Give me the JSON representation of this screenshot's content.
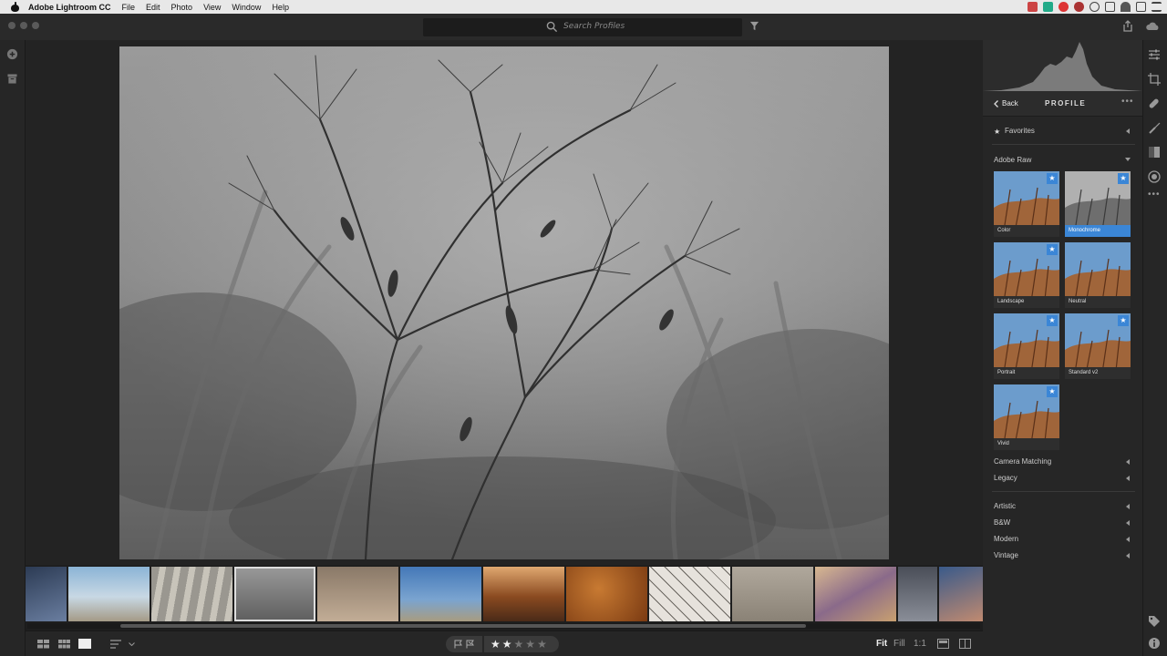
{
  "menubar": {
    "app_name": "Adobe Lightroom CC",
    "items": [
      "File",
      "Edit",
      "Photo",
      "View",
      "Window",
      "Help"
    ]
  },
  "topbar": {
    "search_placeholder": "Search Profiles"
  },
  "panel": {
    "back_label": "Back",
    "title": "PROFILE",
    "favorites_label": "Favorites",
    "group_label": "Adobe Raw",
    "profiles": [
      {
        "name": "Color",
        "favorite": true,
        "selected": false
      },
      {
        "name": "Monochrome",
        "favorite": true,
        "selected": true
      },
      {
        "name": "Landscape",
        "favorite": true,
        "selected": false
      },
      {
        "name": "Neutral",
        "favorite": false,
        "selected": false
      },
      {
        "name": "Portrait",
        "favorite": true,
        "selected": false
      },
      {
        "name": "Standard v2",
        "favorite": true,
        "selected": false
      },
      {
        "name": "Vivid",
        "favorite": true,
        "selected": false
      }
    ],
    "groups_a": [
      "Camera Matching",
      "Legacy"
    ],
    "groups_b": [
      "Artistic",
      "B&W",
      "Modern",
      "Vintage"
    ]
  },
  "bottombar": {
    "rating": 2,
    "max_rating": 5,
    "zoom_fit": "Fit",
    "zoom_fill": "Fill",
    "zoom_1to1": "1:1"
  },
  "colors": {
    "accent": "#3b86d6",
    "panel_bg": "#262626"
  }
}
